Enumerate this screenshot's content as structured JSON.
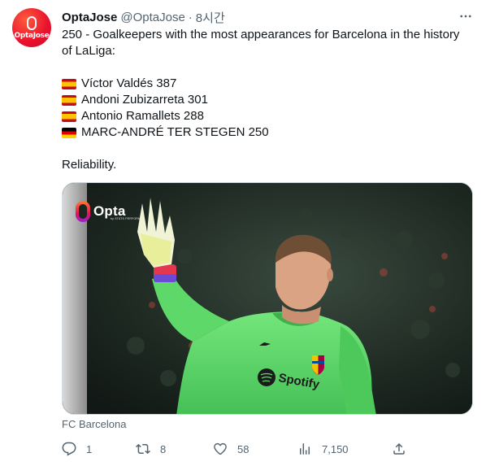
{
  "author": {
    "name": "OptaJose",
    "handle": "@OptaJose",
    "separator": "·",
    "time": "8시간",
    "avatar_text": "OptaJose"
  },
  "more_icon": "more-horizontal-icon",
  "tweet": {
    "intro": "250 - Goalkeepers with the most appearances for Barcelona in the history of LaLiga:",
    "list": [
      {
        "flag": "spain-flag",
        "text": "Víctor Valdés 387"
      },
      {
        "flag": "spain-flag",
        "text": "Andoni Zubizarreta 301"
      },
      {
        "flag": "spain-flag",
        "text": "Antonio Ramallets 288"
      },
      {
        "flag": "germany-flag",
        "text": "MARC-ANDRÉ TER STEGEN 250"
      }
    ],
    "closing": "Reliability."
  },
  "media": {
    "logo_word": "Opta",
    "logo_subtext": "by STATS PERFORM",
    "shirt_text": "Spotify",
    "source": "FC Barcelona"
  },
  "actions": {
    "replies": "1",
    "retweets": "8",
    "likes": "58",
    "views": "7,150"
  },
  "colors": {
    "text": "#0f1419",
    "secondary": "#536471",
    "avatar": "#e8112d",
    "kit_green": "#5fd86a"
  }
}
